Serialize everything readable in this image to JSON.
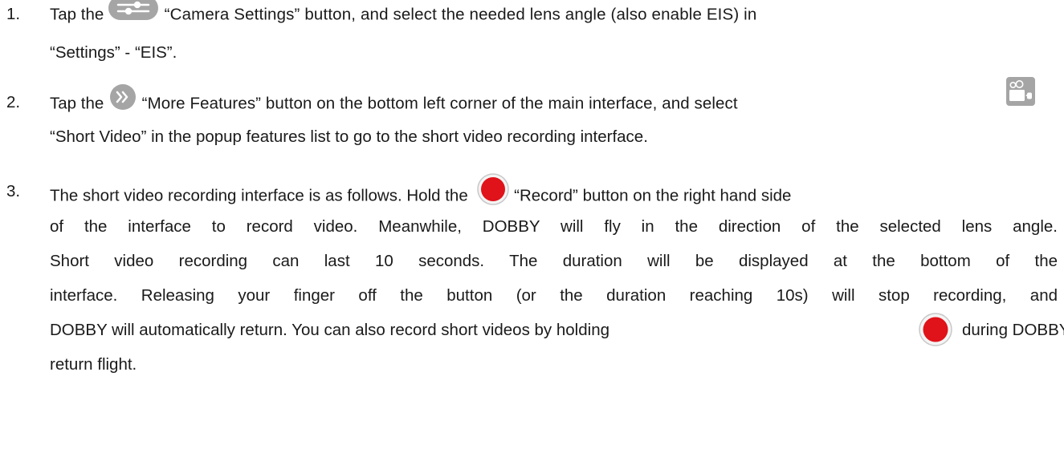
{
  "steps": [
    {
      "number": "1.",
      "lines": [
        "Tap the",
        "“Camera Settings” button, and select the needed lens angle (also enable EIS) in",
        "“Settings” - “EIS”."
      ]
    },
    {
      "number": "2.",
      "lines": [
        "Tap the",
        "“More Features” button on the bottom left corner of the main interface, and select",
        "“Short Video” in the popup features list to go to the short video recording interface."
      ]
    },
    {
      "number": "3.",
      "lines": [
        "The short video recording interface is as follows. Hold the",
        "“Record” button on the right hand side",
        "of the interface to record video. Meanwhile, DOBBY will fly in the direction of the selected lens angle.",
        "Short video recording can last 10 seconds. The duration will be displayed at the bottom of the",
        "interface. Releasing your finger off the button (or the duration reaching 10s) will stop recording, and",
        "DOBBY will automatically return. You can also record short videos by holding",
        "during DOBBY’s",
        "return flight."
      ]
    }
  ],
  "icons": {
    "camera_settings": "sliders-icon",
    "more_features": "double-chevron-right-icon",
    "short_video": "short-video-camera-icon",
    "record": "record-button-icon"
  },
  "colors": {
    "text": "#1a1a1a",
    "icon_gray": "#a5a5a5",
    "record_red": "#e0121a",
    "record_ring": "#c8c8c8"
  }
}
